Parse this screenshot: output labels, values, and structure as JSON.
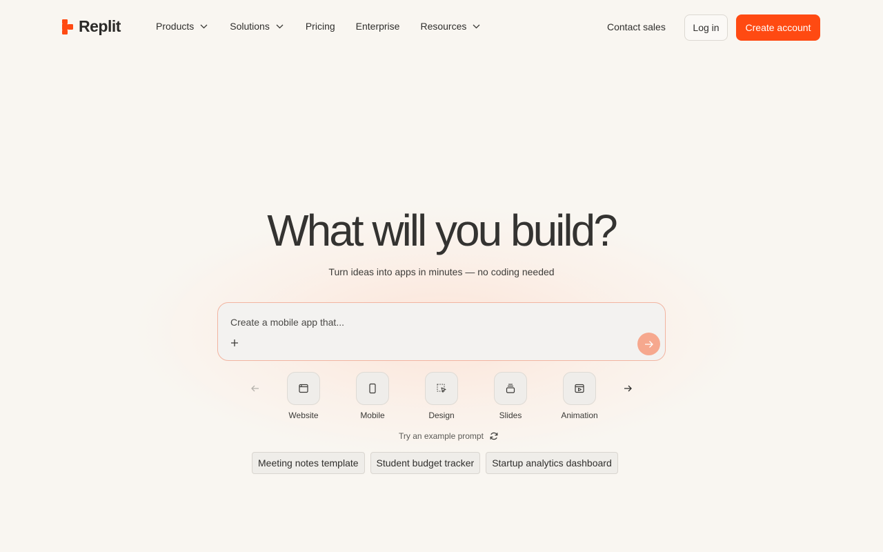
{
  "brand": {
    "name": "Replit",
    "accent": "#ff4a12"
  },
  "nav": {
    "products": "Products",
    "solutions": "Solutions",
    "pricing": "Pricing",
    "enterprise": "Enterprise",
    "resources": "Resources"
  },
  "auth": {
    "contact": "Contact sales",
    "login": "Log in",
    "create": "Create account"
  },
  "hero": {
    "title": "What will you build?",
    "subtitle": "Turn ideas into apps in minutes — no coding needed"
  },
  "prompt": {
    "placeholder": "Create a mobile app that...",
    "value": ""
  },
  "categories": [
    {
      "label": "Website",
      "icon": "browser-window-icon"
    },
    {
      "label": "Mobile",
      "icon": "phone-icon"
    },
    {
      "label": "Design",
      "icon": "selection-cursor-icon"
    },
    {
      "label": "Slides",
      "icon": "slides-stack-icon"
    },
    {
      "label": "Animation",
      "icon": "play-window-icon"
    }
  ],
  "examples": {
    "label": "Try an example prompt",
    "chips": [
      "Meeting notes template",
      "Student budget tracker",
      "Startup analytics dashboard"
    ]
  }
}
